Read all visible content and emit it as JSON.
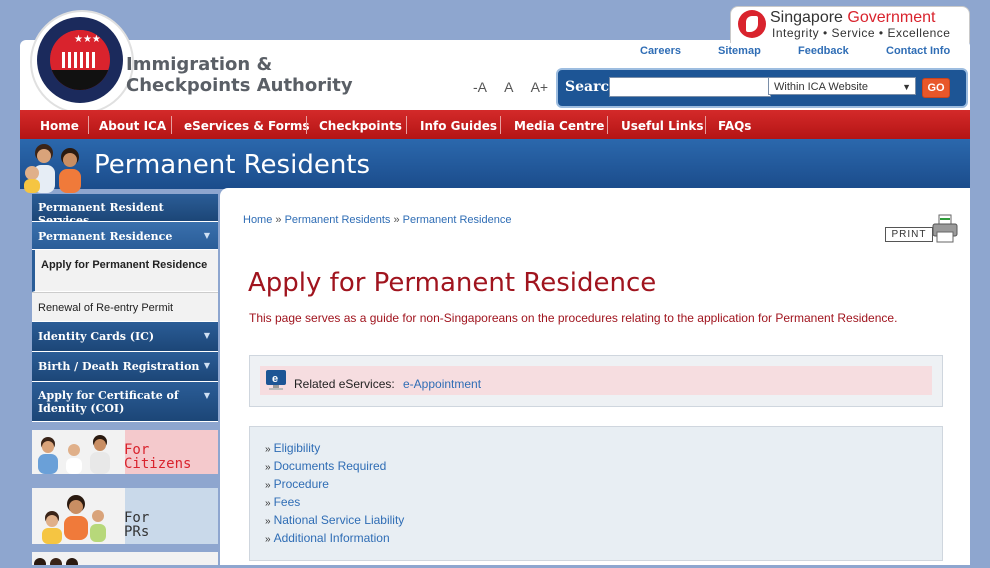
{
  "header": {
    "org_line1": "Immigration &",
    "org_line2": "Checkpoints Authority",
    "font_controls": [
      "-A",
      "A",
      "A+"
    ],
    "sg_gov": {
      "title_part1": "Singapore ",
      "title_part2": "Government",
      "motto": "Integrity • Service • Excellence"
    },
    "top_links": [
      "Careers",
      "Sitemap",
      "Feedback",
      "Contact Info"
    ],
    "search": {
      "label": "Search",
      "value": "",
      "scope": "Within ICA Website",
      "go": "GO"
    }
  },
  "nav": {
    "items": [
      "Home",
      "About ICA",
      "eServices & Forms",
      "Checkpoints",
      "Info Guides",
      "Media Centre",
      "Useful Links",
      "FAQs"
    ]
  },
  "banner": {
    "title": "Permanent Residents"
  },
  "sidebar": {
    "items": [
      {
        "label": "Permanent Resident Services"
      },
      {
        "label": "Permanent Residence"
      },
      {
        "label": "Apply for Permanent Residence"
      },
      {
        "label": "Renewal of Re-entry Permit"
      },
      {
        "label": "Identity Cards (IC)"
      },
      {
        "label": "Birth / Death Registration"
      },
      {
        "label": "Apply for Certificate of Identity (COI)"
      }
    ],
    "cards": [
      {
        "line1": "For",
        "line2": "Citizens"
      },
      {
        "line1": "For",
        "line2": "PRs"
      }
    ]
  },
  "content": {
    "breadcrumb": [
      "Home",
      "Permanent Residents",
      "Permanent Residence"
    ],
    "breadcrumb_sep": "»",
    "print": "PRINT",
    "title": "Apply for Permanent Residence",
    "intro": "This page serves as a guide for non-Singaporeans on the procedures relating to the application for Permanent Residence.",
    "eservices_label": "Related eServices:",
    "eservices_link": "e-Appointment",
    "links": [
      "Eligibility",
      "Documents Required",
      "Procedure",
      "Fees",
      "National Service Liability",
      "Additional Information"
    ]
  },
  "colors": {
    "nav_red": "#c41e1e",
    "banner_blue": "#1d5595",
    "title_red": "#a0141e",
    "link_blue": "#2f6db5"
  }
}
